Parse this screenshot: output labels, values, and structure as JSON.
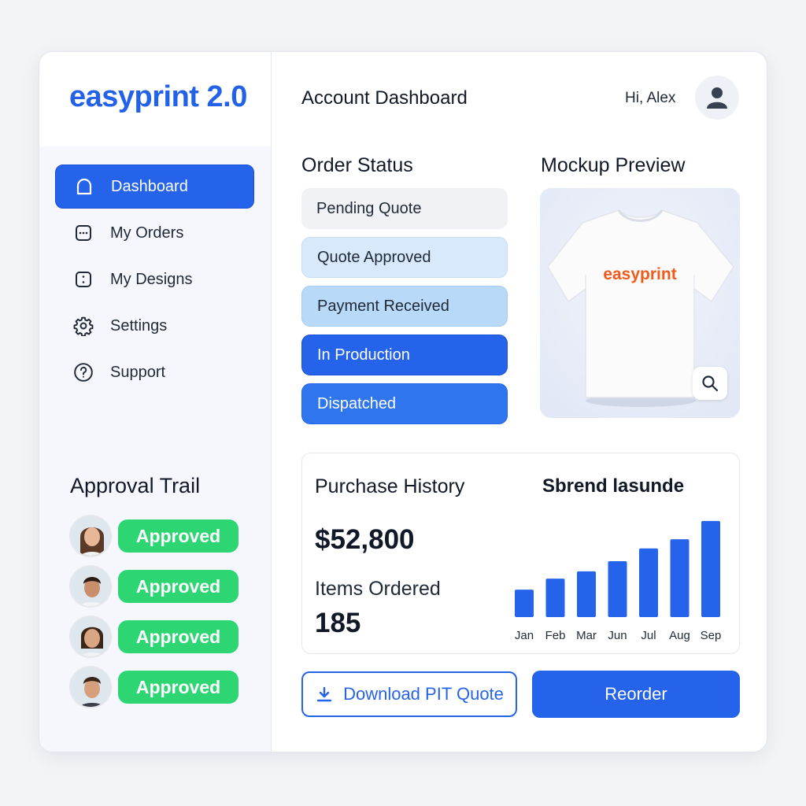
{
  "brand": {
    "name": "easyprint 2.0",
    "color": "#2261e8"
  },
  "sidebar": {
    "items": [
      {
        "label": "Dashboard",
        "icon": "home-icon",
        "active": true
      },
      {
        "label": "My Orders",
        "icon": "orders-icon",
        "active": false
      },
      {
        "label": "My Designs",
        "icon": "designs-icon",
        "active": false
      },
      {
        "label": "Settings",
        "icon": "gear-icon",
        "active": false
      },
      {
        "label": "Support",
        "icon": "help-icon",
        "active": false
      }
    ]
  },
  "approval_trail": {
    "title": "Approval Trail",
    "entries": [
      {
        "status": "Approved"
      },
      {
        "status": "Approved"
      },
      {
        "status": "Approved"
      },
      {
        "status": "Approved"
      }
    ],
    "badge_color": "#2ed573"
  },
  "header": {
    "title": "Account Dashboard",
    "greeting": "Hi, Alex"
  },
  "order_status": {
    "title": "Order Status",
    "steps": [
      "Pending Quote",
      "Quote Approved",
      "Payment Received",
      "In Production",
      "Dispatched"
    ]
  },
  "mockup": {
    "title": "Mockup Preview",
    "shirt_text": "easyprint",
    "shirt_text_color": "#f05a1a"
  },
  "purchase_history": {
    "title": "Purchase History",
    "amount": "$52,800",
    "items_label": "Items Ordered",
    "items_count": "185",
    "chart_title": "Sbrend lasunde"
  },
  "chart_data": {
    "type": "bar",
    "title": "Sbrend lasunde",
    "categories": [
      "Jan",
      "Feb",
      "Mar",
      "Jun",
      "Jul",
      "Aug",
      "Sep"
    ],
    "values": [
      30,
      42,
      50,
      61,
      75,
      85,
      105
    ],
    "ylim": [
      0,
      110
    ],
    "color": "#2563eb",
    "grid": false
  },
  "actions": {
    "download_label": "Download PIT Quote",
    "reorder_label": "Reorder"
  },
  "accent": "#2563eb"
}
